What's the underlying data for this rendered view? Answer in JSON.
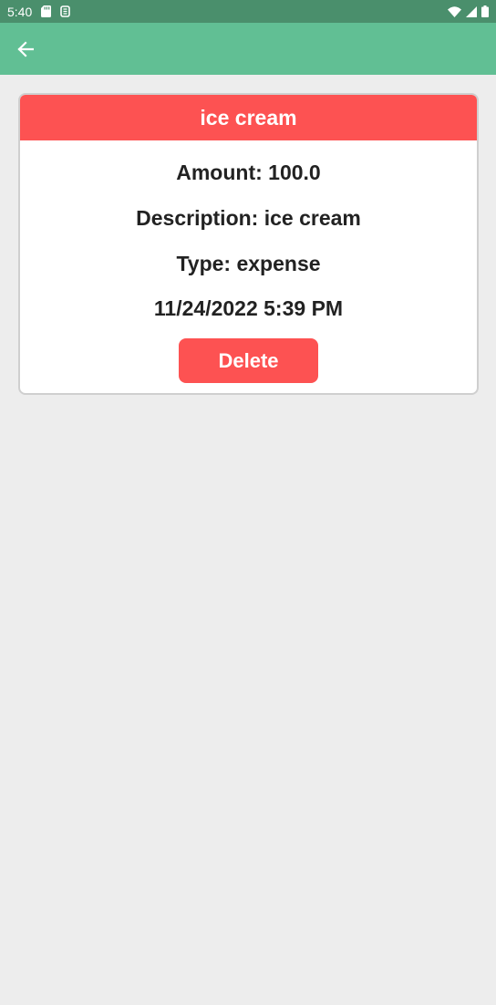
{
  "status_bar": {
    "time": "5:40",
    "icons": [
      "sd-card-icon",
      "app-notification-icon",
      "wifi-icon",
      "cell-signal-icon",
      "battery-icon"
    ],
    "color": "#4a8f6c"
  },
  "app_bar": {
    "back_icon": "arrow-back-icon",
    "color": "#61bf94"
  },
  "transaction": {
    "title": "ice cream",
    "amount_line": "Amount: 100.0",
    "description_line": "Description: ice cream",
    "type_line": "Type: expense",
    "date_line": "11/24/2022 5:39 PM",
    "delete_label": "Delete",
    "accent_color": "#fd5252"
  }
}
